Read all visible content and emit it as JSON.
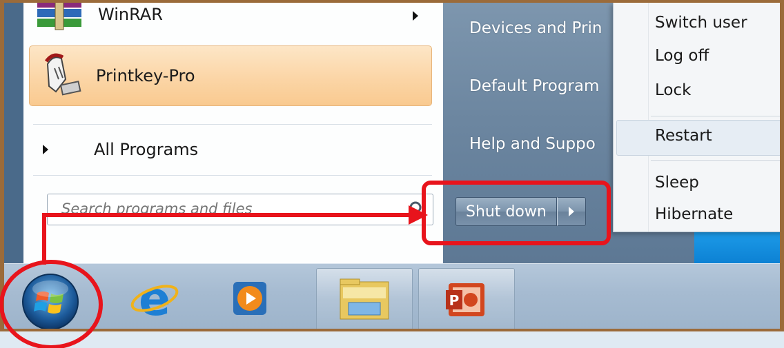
{
  "start_menu": {
    "programs": [
      {
        "label": "WinRAR",
        "icon": "winrar-icon",
        "has_submenu": true
      },
      {
        "label": "Printkey-Pro",
        "icon": "printkey-icon",
        "highlighted": true
      }
    ],
    "all_programs_label": "All Programs",
    "search": {
      "placeholder": "Search programs and files",
      "icon": "search-icon"
    },
    "right_items": [
      "Devices and Prin",
      "Default Program",
      "Help and Suppo"
    ],
    "shutdown": {
      "label": "Shut down",
      "arrow_icon": "chevron-right-icon"
    }
  },
  "power_menu": {
    "items": [
      "Switch user",
      "Log off",
      "Lock",
      "Restart",
      "Sleep",
      "Hibernate"
    ],
    "highlighted": "Restart"
  },
  "taskbar": {
    "items": [
      {
        "name": "start-orb",
        "icon": "windows-orb-icon"
      },
      {
        "name": "internet-explorer",
        "icon": "internet-explorer-icon"
      },
      {
        "name": "media-player",
        "icon": "media-player-icon"
      },
      {
        "name": "file-explorer",
        "icon": "folder-icon"
      },
      {
        "name": "powerpoint",
        "icon": "powerpoint-icon"
      }
    ]
  },
  "annotation_color": "#e8141c",
  "accents": {
    "highlight_orange": "#fbd5a6",
    "start_pane_blue": "#6c86a0",
    "desktop_blue": "#0b7fd2"
  }
}
